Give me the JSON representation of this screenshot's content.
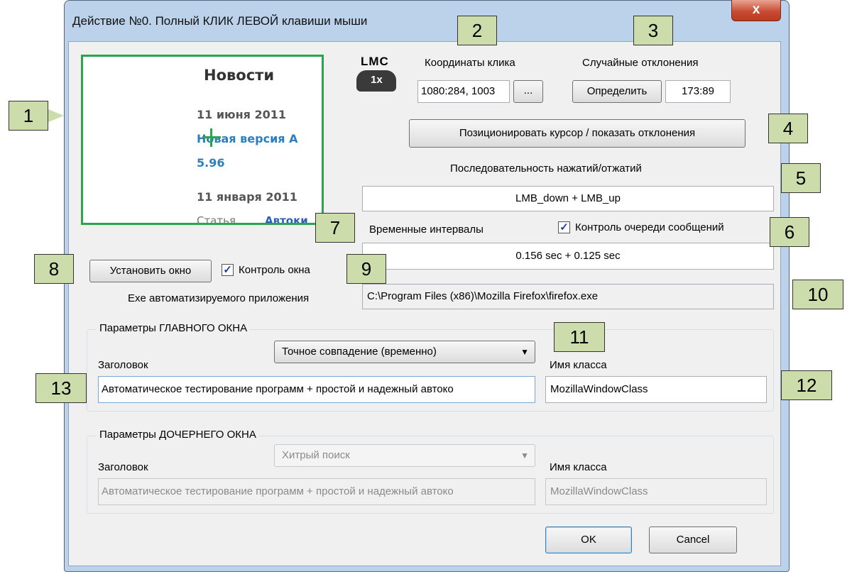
{
  "window": {
    "title": "Действие №0. Полный КЛИК ЛЕВОЙ клавиши мыши",
    "close_label": "x"
  },
  "preview": {
    "heading": "Новости",
    "date1": "11 июня 2011",
    "link1": "Новая версия А",
    "link1b": "5.96",
    "date2": "11 января 2011",
    "article": "Статья",
    "article_link": "Автоки"
  },
  "lmc": {
    "label": "LMC",
    "count": "1x"
  },
  "coords": {
    "label": "Координаты клика",
    "value": "1080:284, 1003",
    "browse_label": "..."
  },
  "deviation": {
    "label": "Случайные отклонения",
    "define_label": "Определить",
    "value": "173:89"
  },
  "position_button": "Позиционировать курсор / показать отклонения",
  "sequence": {
    "label": "Последовательность нажатий/отжатий",
    "value": "LMB_down + LMB_up"
  },
  "intervals": {
    "label": "Временные интервалы",
    "value": "0.156 sec + 0.125 sec"
  },
  "queue_control": {
    "label": "Контроль очереди сообщений",
    "checked": true
  },
  "set_window_button": "Установить окно",
  "window_control": {
    "label": "Контроль окна",
    "checked": true
  },
  "exe": {
    "label": "Exe автоматизируемого приложения",
    "value": "C:\\Program Files (x86)\\Mozilla Firefox\\firefox.exe"
  },
  "main_window": {
    "group_title": "Параметры ГЛАВНОГО ОКНА",
    "match_mode": "Точное совпадение (временно)",
    "title_label": "Заголовок",
    "title_value": "Автоматическое тестирование программ + простой и надежный автоко",
    "class_label": "Имя класса",
    "class_value": "MozillaWindowClass"
  },
  "child_window": {
    "group_title": "Параметры ДОЧЕРНЕГО ОКНА",
    "match_mode": "Хитрый поиск",
    "title_label": "Заголовок",
    "title_value": "Автоматическое тестирование программ + простой и надежный автоко",
    "class_label": "Имя класса",
    "class_value": "MozillaWindowClass"
  },
  "ok_label": "OK",
  "cancel_label": "Cancel",
  "callouts": [
    "1",
    "2",
    "3",
    "4",
    "5",
    "6",
    "7",
    "8",
    "9",
    "10",
    "11",
    "12",
    "13"
  ],
  "colors": {
    "callout": "#ccdcaa",
    "preview_border": "#2aa44f",
    "link": "#2a7fc0",
    "close": "#c84d33"
  }
}
